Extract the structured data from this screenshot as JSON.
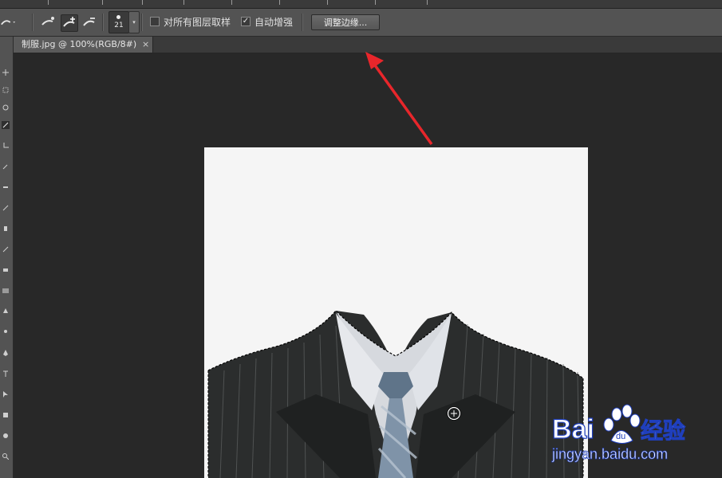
{
  "options_bar": {
    "brush_size": "21",
    "sample_all_layers_label": "对所有图层取样",
    "sample_all_layers_checked": false,
    "auto_enhance_label": "自动增强",
    "auto_enhance_checked": true,
    "refine_edge_label": "调整边缘..."
  },
  "document_tab": {
    "title": "制服.jpg @ 100%(RGB/8#)",
    "close_glyph": "×"
  },
  "watermark": {
    "brand_left": "Bai",
    "brand_right": "经验",
    "url": "jingyan.baidu.com"
  },
  "colors": {
    "arrow": "#e8262b",
    "selection": "#000000",
    "watermark_blue": "#1f3fbd"
  },
  "icons": [
    "quick-selection-tool-icon",
    "new-selection-icon",
    "add-to-selection-icon",
    "subtract-from-selection-icon",
    "brush-size-icon",
    "close-icon",
    "cursor-crosshair-icon",
    "baidu-paw-icon"
  ]
}
